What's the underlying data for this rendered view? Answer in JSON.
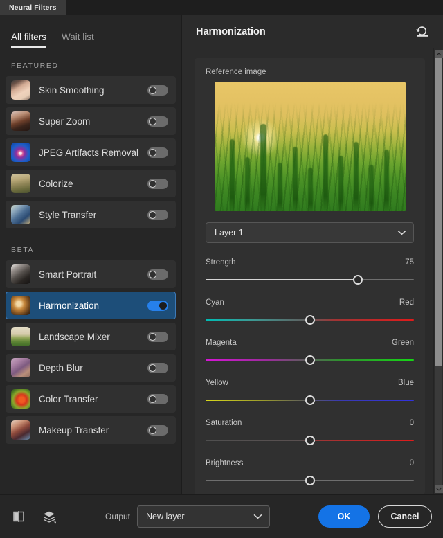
{
  "window": {
    "panel_tab": "Neural Filters"
  },
  "left_panel": {
    "tabs": [
      {
        "label": "All filters",
        "active": true
      },
      {
        "label": "Wait list",
        "active": false
      }
    ],
    "groups": [
      {
        "label": "FEATURED",
        "filters": [
          {
            "name": "Skin Smoothing",
            "enabled": false,
            "selected": false,
            "thumb": "face-closeup-thumb"
          },
          {
            "name": "Super Zoom",
            "enabled": false,
            "selected": false,
            "thumb": "portrait-glasses-thumb"
          },
          {
            "name": "JPEG Artifacts Removal",
            "enabled": false,
            "selected": false,
            "thumb": "blue-gem-thumb"
          },
          {
            "name": "Colorize",
            "enabled": false,
            "selected": false,
            "thumb": "sepia-photo-thumb"
          },
          {
            "name": "Style Transfer",
            "enabled": false,
            "selected": false,
            "thumb": "painting-style-thumb"
          }
        ]
      },
      {
        "label": "BETA",
        "filters": [
          {
            "name": "Smart Portrait",
            "enabled": false,
            "selected": false,
            "thumb": "bw-portrait-thumb"
          },
          {
            "name": "Harmonization",
            "enabled": true,
            "selected": true,
            "thumb": "woman-golden-thumb"
          },
          {
            "name": "Landscape Mixer",
            "enabled": false,
            "selected": false,
            "thumb": "landscape-field-thumb"
          },
          {
            "name": "Depth Blur",
            "enabled": false,
            "selected": false,
            "thumb": "purple-blur-thumb"
          },
          {
            "name": "Color Transfer",
            "enabled": false,
            "selected": false,
            "thumb": "fruit-color-thumb"
          },
          {
            "name": "Makeup Transfer",
            "enabled": false,
            "selected": false,
            "thumb": "makeup-face-thumb"
          }
        ]
      }
    ]
  },
  "right_panel": {
    "title": "Harmonization",
    "reset_icon": "reset-arrow-icon",
    "reference": {
      "label": "Reference image",
      "image_alt": "sunset-wheat-field-photo",
      "layer_select": {
        "value": "Layer 1",
        "chevron": "chevron-down-icon"
      }
    },
    "sliders": [
      {
        "name": "strength",
        "left_label": "Strength",
        "right_label": "75",
        "value": 75,
        "min": 0,
        "max": 100,
        "percent": 73,
        "track": "plain"
      },
      {
        "name": "cyan-red",
        "left_label": "Cyan",
        "right_label": "Red",
        "value": 0,
        "min": -100,
        "max": 100,
        "percent": 50,
        "track": "cyan-red"
      },
      {
        "name": "magenta-green",
        "left_label": "Magenta",
        "right_label": "Green",
        "value": 0,
        "min": -100,
        "max": 100,
        "percent": 50,
        "track": "magenta-green"
      },
      {
        "name": "yellow-blue",
        "left_label": "Yellow",
        "right_label": "Blue",
        "value": 0,
        "min": -100,
        "max": 100,
        "percent": 50,
        "track": "yellow-blue"
      },
      {
        "name": "saturation",
        "left_label": "Saturation",
        "right_label": "0",
        "value": 0,
        "min": -100,
        "max": 100,
        "percent": 50,
        "track": "saturation"
      },
      {
        "name": "brightness",
        "left_label": "Brightness",
        "right_label": "0",
        "value": 0,
        "min": -100,
        "max": 100,
        "percent": 50,
        "track": "plain-dim"
      }
    ],
    "scrollbar": {
      "up_icon": "scroll-up-arrow-icon",
      "down_icon": "scroll-down-arrow-icon"
    }
  },
  "footer": {
    "preview_icon": "split-preview-icon",
    "layers_icon": "layers-stack-icon",
    "output_label": "Output",
    "output_value": "New layer",
    "output_chevron": "chevron-down-icon",
    "ok_label": "OK",
    "cancel_label": "Cancel"
  },
  "colors": {
    "accent_blue": "#1473e6",
    "toggle_on": "#2680eb",
    "row_selected_bg": "#1d4e79",
    "row_selected_border": "#3d7ab8",
    "panel_bg": "#262626",
    "right_bg": "#2b2b2b",
    "row_bg": "#303030"
  }
}
